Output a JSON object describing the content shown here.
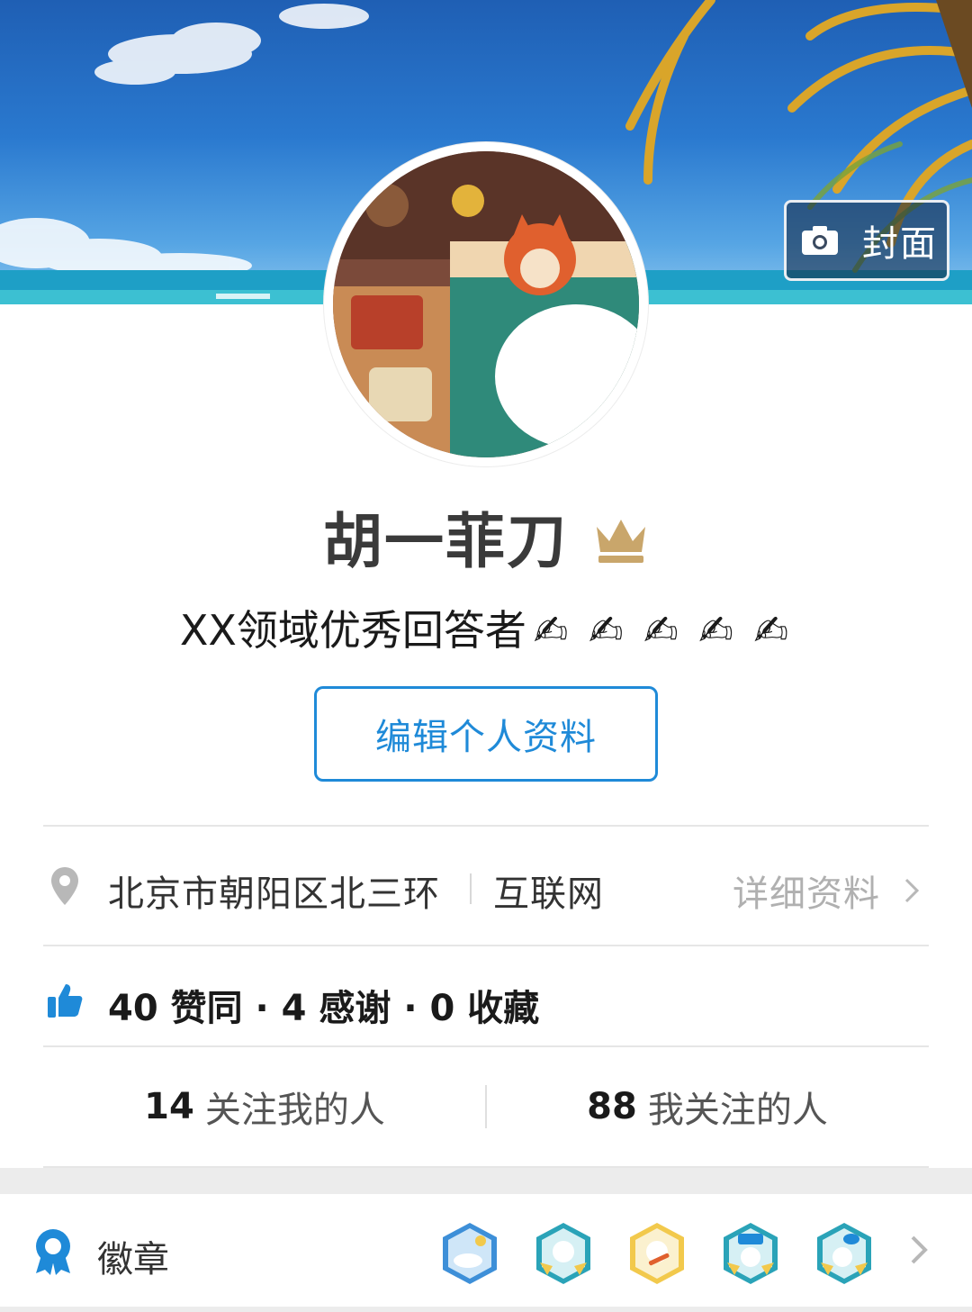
{
  "cover": {
    "button_label": "封面",
    "camera_icon": "camera-icon"
  },
  "profile": {
    "name": "胡一菲刀",
    "member_badge_icon": "crown-icon",
    "bio": "XX领域优秀回答者",
    "bio_emoji": "✍ ✍ ✍ ✍ ✍",
    "edit_button_label": "编辑个人资料"
  },
  "info": {
    "location": "北京市朝阳区北三环",
    "industry": "互联网",
    "detail_link": "详细资料"
  },
  "stats": {
    "summary": "40 赞同 · 4 感谢 · 0 收藏"
  },
  "follow": {
    "followers_count": "14",
    "followers_label": "关注我的人",
    "following_count": "88",
    "following_label": "我关注的人"
  },
  "badges": {
    "title": "徽章",
    "items": [
      "badge-sleeping-icon",
      "badge-thinking-icon",
      "badge-writing-icon",
      "badge-thanks-icon",
      "badge-comment-icon"
    ]
  },
  "colors": {
    "accent": "#1f8ad8",
    "crown": "#c9a66b"
  }
}
